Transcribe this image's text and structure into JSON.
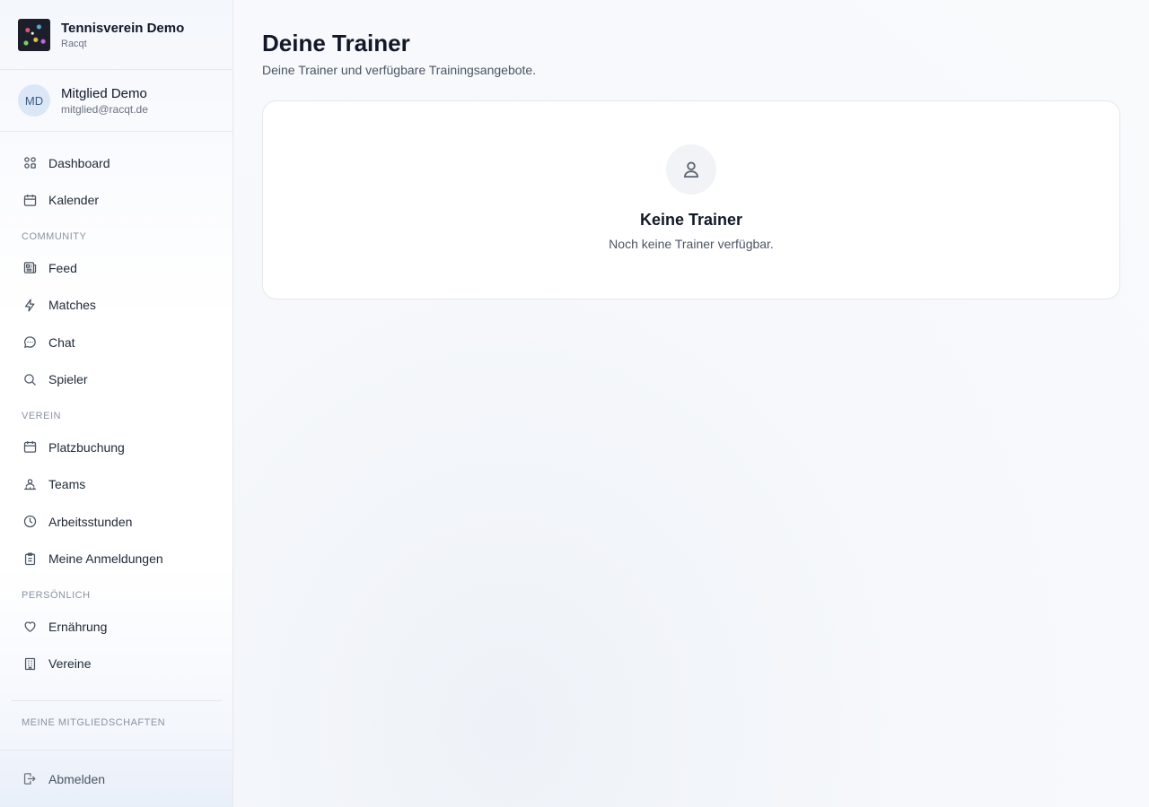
{
  "club": {
    "name": "Tennisverein Demo",
    "subtitle": "Racqt"
  },
  "user": {
    "initials": "MD",
    "name": "Mitglied Demo",
    "email": "mitglied@racqt.de"
  },
  "nav": {
    "main": [
      {
        "label": "Dashboard",
        "icon": "dashboard-icon"
      },
      {
        "label": "Kalender",
        "icon": "calendar-icon"
      }
    ],
    "community_label": "COMMUNITY",
    "community": [
      {
        "label": "Feed",
        "icon": "newspaper-icon"
      },
      {
        "label": "Matches",
        "icon": "lightning-icon"
      },
      {
        "label": "Chat",
        "icon": "chat-bubble-icon"
      },
      {
        "label": "Spieler",
        "icon": "search-icon"
      }
    ],
    "verein_label": "VEREIN",
    "verein": [
      {
        "label": "Platzbuchung",
        "icon": "calendar-icon"
      },
      {
        "label": "Teams",
        "icon": "team-icon"
      },
      {
        "label": "Arbeitsstunden",
        "icon": "clock-icon"
      },
      {
        "label": "Meine Anmeldungen",
        "icon": "clipboard-icon"
      }
    ],
    "persoenlich_label": "PERSÖNLICH",
    "persoenlich": [
      {
        "label": "Ernährung",
        "icon": "heart-icon"
      },
      {
        "label": "Vereine",
        "icon": "building-icon"
      }
    ],
    "memberships_label": "MEINE MITGLIEDSCHAFTEN",
    "logout_label": "Abmelden"
  },
  "page": {
    "title": "Deine Trainer",
    "subtitle": "Deine Trainer und verfügbare Trainingsangebote."
  },
  "empty_state": {
    "icon": "user-icon",
    "title": "Keine Trainer",
    "text": "Noch keine Trainer verfügbar."
  }
}
